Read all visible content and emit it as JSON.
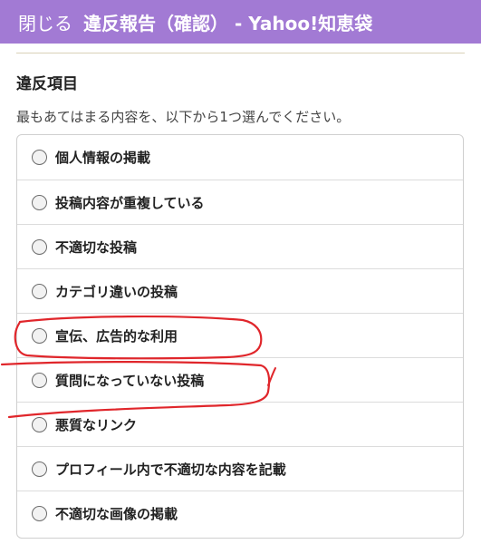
{
  "header": {
    "close_label": "閉じる",
    "title": "違反報告（確認） - Yahoo!知恵袋"
  },
  "section": {
    "title": "違反項目",
    "instruction": "最もあてはまる内容を、以下から1つ選んでください。"
  },
  "options": [
    {
      "label": "個人情報の掲載"
    },
    {
      "label": "投稿内容が重複している"
    },
    {
      "label": "不適切な投稿"
    },
    {
      "label": "カテゴリ違いの投稿"
    },
    {
      "label": "宣伝、広告的な利用"
    },
    {
      "label": "質問になっていない投稿"
    },
    {
      "label": "悪質なリンク"
    },
    {
      "label": "プロフィール内で不適切な内容を記載"
    },
    {
      "label": "不適切な画像の掲載"
    }
  ],
  "colors": {
    "header_bg": "#a27ad4",
    "annotation": "#e0262b"
  }
}
